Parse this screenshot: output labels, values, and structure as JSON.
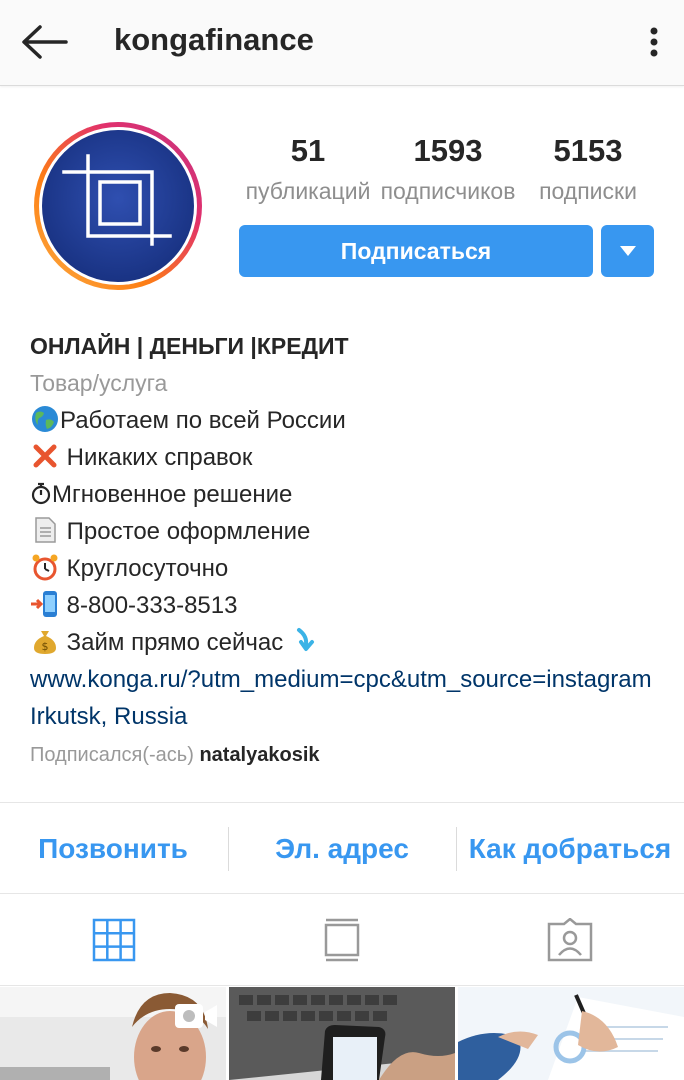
{
  "header": {
    "username": "kongafinance",
    "back_icon": "arrow-back-icon",
    "more_icon": "more-vertical-icon"
  },
  "avatar": {
    "icon": "crop-logo-icon",
    "ring_colors": [
      "#c13584",
      "#e1306c",
      "#fd7e14",
      "#fcaf45"
    ],
    "fill": "#1f3a93"
  },
  "stats": {
    "posts": {
      "value": "51",
      "label": "публикаций"
    },
    "followers": {
      "value": "1593",
      "label": "подписчиков"
    },
    "following": {
      "value": "5153",
      "label": "подписки"
    }
  },
  "follow_button": {
    "label": "Подписаться",
    "color": "#3897f0"
  },
  "dropdown_icon": "caret-down-icon",
  "bio": {
    "name": "ОНЛАЙН | ДЕНЬГИ |КРЕДИТ",
    "category": "Товар/услуга",
    "lines": [
      {
        "icon": "globe-emoji",
        "text": "Работаем по всей России"
      },
      {
        "icon": "cross-mark-emoji",
        "text": " Никаких справок"
      },
      {
        "icon": "stopwatch-emoji",
        "text": "Мгновенное решение"
      },
      {
        "icon": "page-emoji",
        "text": " Простое оформление"
      },
      {
        "icon": "alarm-clock-emoji",
        "text": " Круглосуточно"
      },
      {
        "icon": "calling-phone-emoji",
        "text": " 8-800-333-8513"
      },
      {
        "icon": "money-bag-emoji",
        "text": " Займ прямо сейчас "
      }
    ],
    "trailing_icon": "arrow-down-emoji",
    "link": "www.konga.ru/?utm_medium=cpc&utm_source=instagram",
    "location": "Irkutsk, Russia",
    "followed_by_prefix": "Подписался(-ась) ",
    "followed_by_user": "natalyakosik"
  },
  "actions": {
    "call": "Позвонить",
    "email": "Эл. адрес",
    "directions": "Как добраться"
  },
  "tabs": [
    {
      "icon": "grid-icon",
      "active": true
    },
    {
      "icon": "feed-icon",
      "active": false
    },
    {
      "icon": "tagged-icon",
      "active": false
    }
  ],
  "thumbnails": [
    {
      "subject": "man-portrait",
      "icon": "video-camera-icon"
    },
    {
      "subject": "laptop-and-phone"
    },
    {
      "subject": "signing-documents"
    }
  ]
}
